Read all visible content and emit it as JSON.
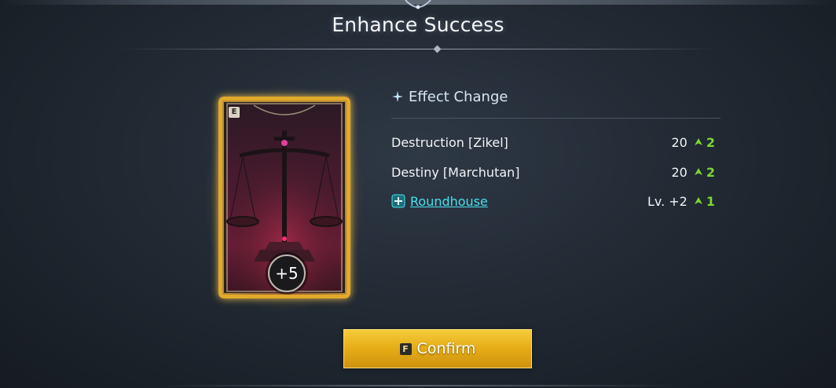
{
  "dialog": {
    "title": "Enhance Success"
  },
  "card": {
    "grade_letter": "E",
    "enhance_level": "+5",
    "art": "scales-of-justice-card-art"
  },
  "effects": {
    "header": "Effect Change",
    "rows": [
      {
        "name": "Destruction [Zikel]",
        "value": "20",
        "delta": "2",
        "is_link": false
      },
      {
        "name": "Destiny [Marchutan]",
        "value": "20",
        "delta": "2",
        "is_link": false
      },
      {
        "name": "Roundhouse",
        "value": "Lv. +2",
        "delta": "1",
        "is_link": true,
        "icon": "skill-plus-icon"
      }
    ]
  },
  "confirm": {
    "key": "F",
    "label": "Confirm"
  },
  "colors": {
    "accent_gold": "#e5ac16",
    "link_cyan": "#49e0f0",
    "increase_green": "#7cd632"
  }
}
